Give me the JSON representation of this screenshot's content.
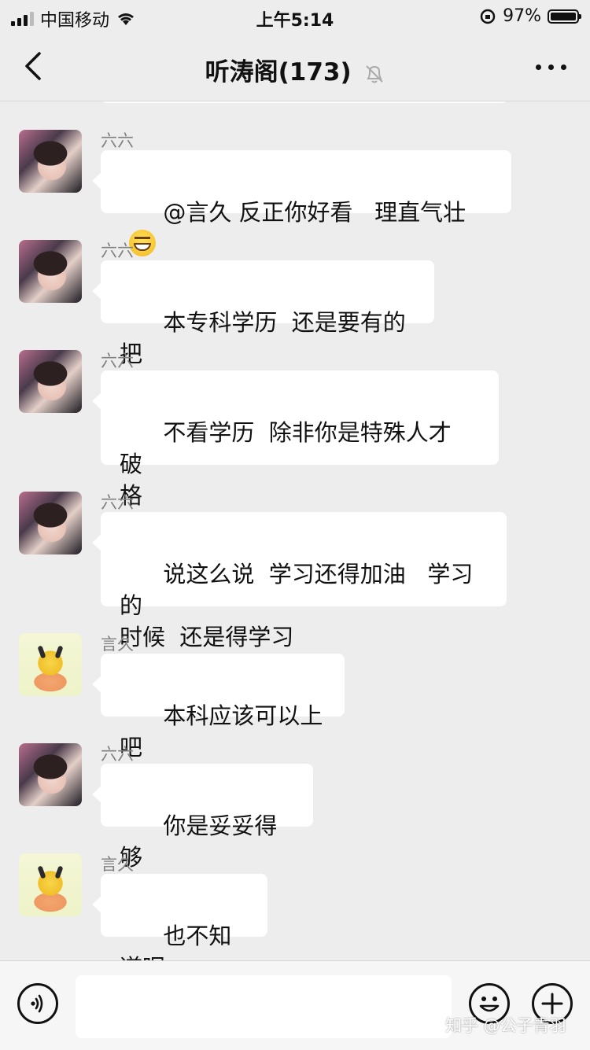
{
  "status_bar": {
    "carrier": "中国移动",
    "time": "上午5:14",
    "battery": "97%",
    "battery_level": 0.97
  },
  "nav": {
    "title": "听涛阁(173)",
    "back_icon": "chevron-left-icon",
    "mute_icon": "bell-off-icon",
    "more_icon": "more-dots-icon"
  },
  "messages": [
    {
      "sender": "六六",
      "avatar": "liuliu",
      "text": "@言久 反正你好看   理直气壮",
      "emoji": "grinning-face-icon"
    },
    {
      "sender": "六六",
      "avatar": "liuliu",
      "text": "本专科学历  还是要有的把"
    },
    {
      "sender": "六六",
      "avatar": "liuliu",
      "text": "不看学历  除非你是特殊人才  破\n格"
    },
    {
      "sender": "六六",
      "avatar": "liuliu",
      "text": "说这么说  学习还得加油   学习的\n时候  还是得学习"
    },
    {
      "sender": "言久",
      "avatar": "yanjiu",
      "text": "本科应该可以上吧"
    },
    {
      "sender": "六六",
      "avatar": "liuliu",
      "text": "你是妥妥得 够"
    },
    {
      "sender": "言久",
      "avatar": "yanjiu",
      "text": "也不知道呢"
    }
  ],
  "input_bar": {
    "voice_icon": "voice-icon",
    "emoji_icon": "smiley-icon",
    "plus_icon": "plus-icon"
  },
  "watermark": "知乎 @公子青羽"
}
